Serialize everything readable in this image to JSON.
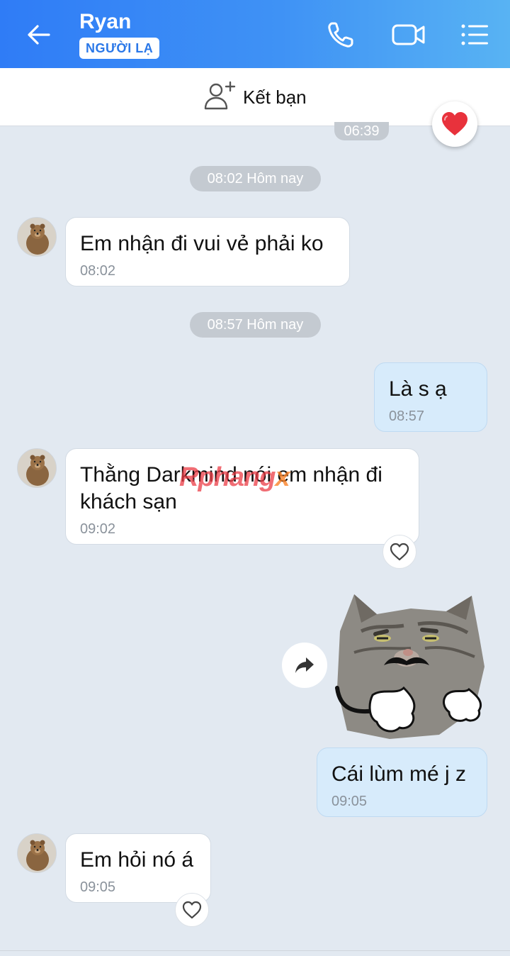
{
  "header": {
    "title": "Ryan",
    "badge": "NGƯỜI LẠ",
    "icons": [
      "back-arrow-icon",
      "phone-icon",
      "video-camera-icon",
      "list-menu-icon"
    ]
  },
  "friend_bar": {
    "label": "Kết bạn",
    "icon": "add-user-icon"
  },
  "time_pills": {
    "partial": "06:39",
    "first": "08:02 Hôm nay",
    "second": "08:57 Hôm nay"
  },
  "messages": [
    {
      "direction": "in",
      "text": "Em nhận đi vui vẻ phải ko",
      "time": "08:02"
    },
    {
      "direction": "out",
      "text": "Là s ạ",
      "time": "08:57"
    },
    {
      "direction": "in",
      "text_line1": "Thằng Darkmind nói em nhận đi",
      "text_line2": "khách sạn",
      "time": "09:02"
    },
    {
      "direction": "out",
      "type": "sticker",
      "sticker": "cat-mustache-shrug-sticker"
    },
    {
      "direction": "out",
      "text": "Cái lùm mé j z",
      "time": "09:05"
    },
    {
      "direction": "in",
      "text": "Em hỏi nó á",
      "time": "09:05"
    }
  ],
  "watermark": {
    "main": "Rphang",
    "suffix": "x"
  },
  "colors": {
    "header_start": "#2f7cf6",
    "header_end": "#58b3f3",
    "chat_bg": "#e2e9f1",
    "outgoing_bubble": "#d7ebfb",
    "incoming_bubble": "#ffffff",
    "heart": "#e8323c"
  }
}
